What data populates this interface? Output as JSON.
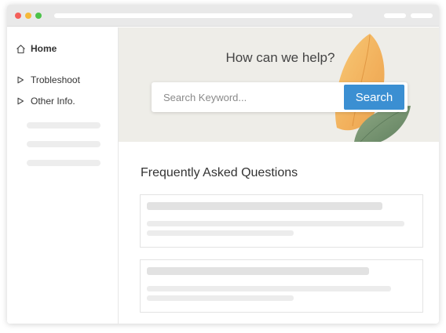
{
  "colors": {
    "dot_red": "#f45f5a",
    "dot_yellow": "#f5b93a",
    "dot_green": "#4cc24a",
    "accent": "#3b8fd2"
  },
  "sidebar": {
    "items": [
      {
        "label": "Home",
        "icon": "home-icon"
      },
      {
        "label": "Trobleshoot",
        "icon": "triangle-right-icon"
      },
      {
        "label": "Other Info.",
        "icon": "triangle-right-icon"
      }
    ]
  },
  "hero": {
    "title": "How can we help?",
    "search_placeholder": "Search Keyword...",
    "search_button": "Search"
  },
  "faq": {
    "title": "Frequently Asked Questions"
  }
}
